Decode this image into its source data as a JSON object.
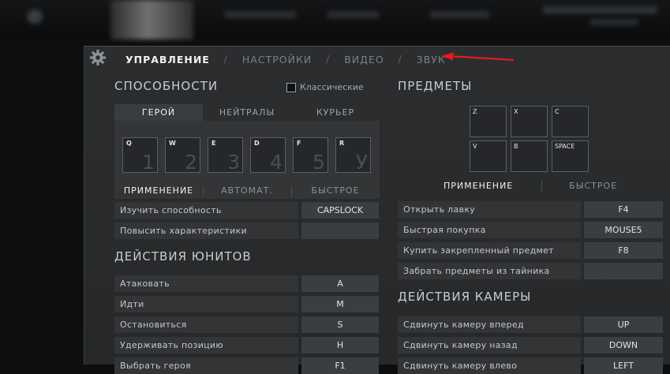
{
  "nav": {
    "tabs": [
      "УПРАВЛЕНИЕ",
      "НАСТРОЙКИ",
      "ВИДЕО",
      "ЗВУК"
    ],
    "separator": "/"
  },
  "colors": {
    "arrow": "#e8191d",
    "panel": "#2a2c2e",
    "active_text": "#f2f2f2"
  },
  "abilities": {
    "heading": "СПОСОБНОСТИ",
    "classic_label": "Классические",
    "tabs": [
      "ГЕРОЙ",
      "НЕЙТРАЛЫ",
      "КУРЬЕР"
    ],
    "slots": [
      {
        "key": "Q",
        "num": "1"
      },
      {
        "key": "W",
        "num": "2"
      },
      {
        "key": "E",
        "num": "3"
      },
      {
        "key": "D",
        "num": "4"
      },
      {
        "key": "F",
        "num": "5"
      },
      {
        "key": "R",
        "num": "У"
      }
    ],
    "cast_modes": [
      "ПРИМЕНЕНИЕ",
      "АВТОМАТ.",
      "БЫСТРОЕ"
    ],
    "rows": [
      {
        "label": "Изучить способность",
        "key": "CAPSLOCK"
      },
      {
        "label": "Повысить характеристики",
        "key": ""
      }
    ]
  },
  "unit_actions": {
    "heading": "ДЕЙСТВИЯ ЮНИТОВ",
    "rows": [
      {
        "label": "Атаковать",
        "key": "A"
      },
      {
        "label": "Идти",
        "key": "M"
      },
      {
        "label": "Остановиться",
        "key": "S"
      },
      {
        "label": "Удерживать позицию",
        "key": "H"
      },
      {
        "label": "Выбрать героя",
        "key": "F1"
      }
    ]
  },
  "items": {
    "heading": "ПРЕДМЕТЫ",
    "slots": [
      "Z",
      "X",
      "C",
      "V",
      "B",
      "SPACE"
    ],
    "cast_modes": [
      "ПРИМЕНЕНИЕ",
      "БЫСТРОЕ"
    ],
    "rows": [
      {
        "label": "Открыть лавку",
        "key": "F4"
      },
      {
        "label": "Быстрая покупка",
        "key": "MOUSE5"
      },
      {
        "label": "Купить закрепленный предмет",
        "key": "F8"
      },
      {
        "label": "Забрать предметы из тайника",
        "key": ""
      }
    ]
  },
  "camera": {
    "heading": "ДЕЙСТВИЯ КАМЕРЫ",
    "rows": [
      {
        "label": "Сдвинуть камеру вперед",
        "key": "UP"
      },
      {
        "label": "Сдвинуть камеру назад",
        "key": "DOWN"
      },
      {
        "label": "Сдвинуть камеру влево",
        "key": "LEFT"
      }
    ]
  }
}
